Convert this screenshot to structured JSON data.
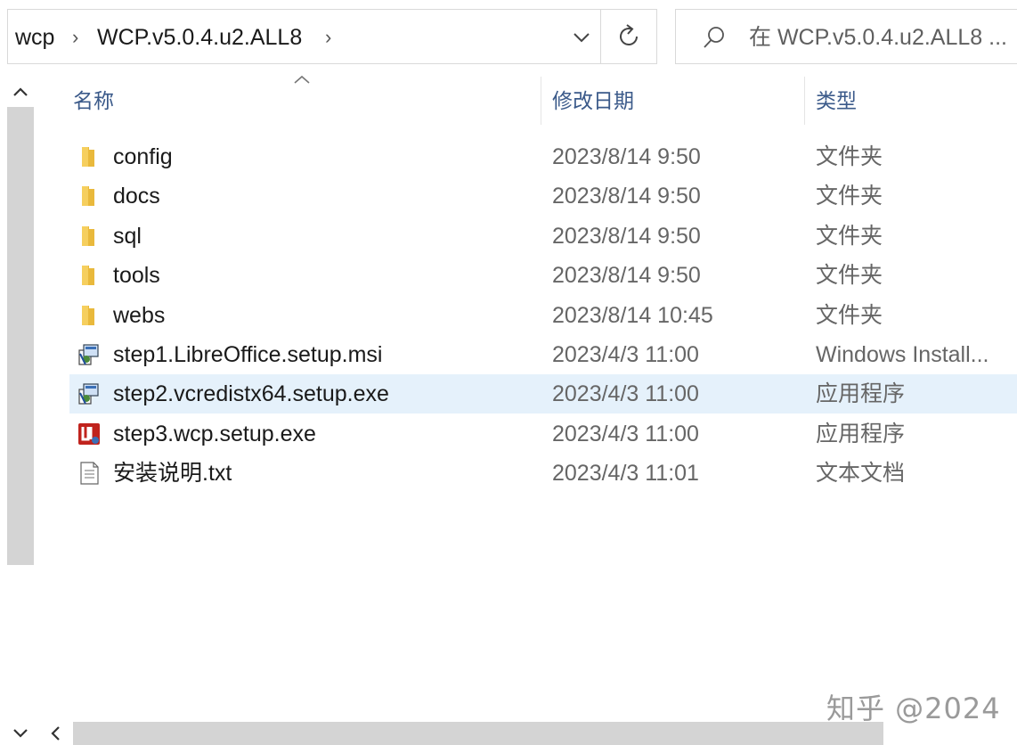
{
  "breadcrumb": {
    "items": [
      "wcp",
      "WCP.v5.0.4.u2.ALL8"
    ]
  },
  "search": {
    "placeholder": "在 WCP.v5.0.4.u2.ALL8 ..."
  },
  "columns": {
    "name": "名称",
    "date": "修改日期",
    "type": "类型"
  },
  "files": [
    {
      "name": "config",
      "date": "2023/8/14 9:50",
      "type": "文件夹",
      "icon": "folder-icon"
    },
    {
      "name": "docs",
      "date": "2023/8/14 9:50",
      "type": "文件夹",
      "icon": "folder-icon"
    },
    {
      "name": "sql",
      "date": "2023/8/14 9:50",
      "type": "文件夹",
      "icon": "folder-icon"
    },
    {
      "name": "tools",
      "date": "2023/8/14 9:50",
      "type": "文件夹",
      "icon": "folder-icon"
    },
    {
      "name": "webs",
      "date": "2023/8/14 10:45",
      "type": "文件夹",
      "icon": "folder-icon"
    },
    {
      "name": "step1.LibreOffice.setup.msi",
      "date": "2023/4/3 11:00",
      "type": "Windows Install...",
      "icon": "installer-icon"
    },
    {
      "name": "step2.vcredistx64.setup.exe",
      "date": "2023/4/3 11:00",
      "type": "应用程序",
      "icon": "installer-icon",
      "selected": true
    },
    {
      "name": "step3.wcp.setup.exe",
      "date": "2023/4/3 11:00",
      "type": "应用程序",
      "icon": "wcp-app-icon"
    },
    {
      "name": "安装说明.txt",
      "date": "2023/4/3 11:01",
      "type": "文本文档",
      "icon": "text-file-icon"
    }
  ],
  "watermark": "知乎 @2024",
  "colors": {
    "selected_row": "#e5f1fb",
    "folder": "#f2c14e",
    "header_text": "#3b5a8a"
  }
}
